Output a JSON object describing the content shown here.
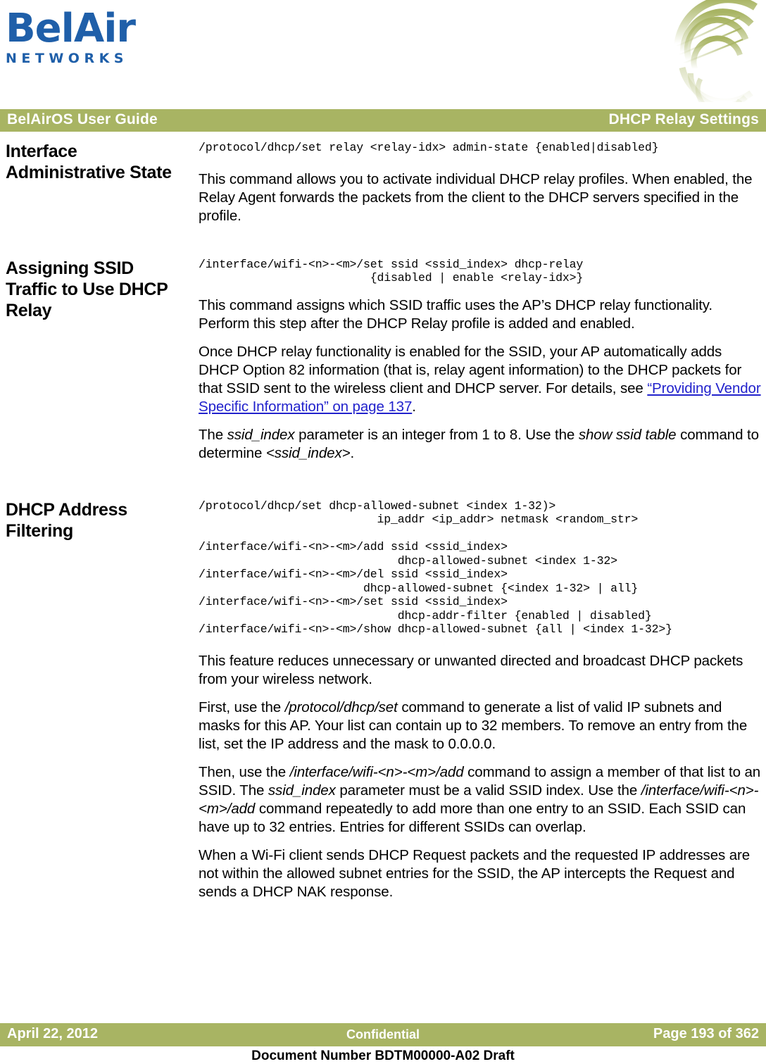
{
  "brand": {
    "logo_word": "BelAir",
    "logo_sub": "NETWORKS",
    "logo_color": "#1f5fa9",
    "accent_color": "#a8b463",
    "link_color": "#2222cc",
    "swoosh_icon": "wireless-swoosh-icon"
  },
  "header": {
    "left": "BelAirOS User Guide",
    "right": "DHCP Relay Settings"
  },
  "sections": [
    {
      "heading": "Interface Administrative State",
      "code": "/protocol/dhcp/set relay <relay-idx> admin-state {enabled|disabled}",
      "paragraphs": [
        "This command allows you to activate individual DHCP relay profiles. When enabled, the Relay Agent forwards the packets from the client to the DHCP servers specified in the profile."
      ]
    },
    {
      "heading": "Assigning SSID Traffic to Use DHCP Relay",
      "code": "/interface/wifi-<n>-<m>/set ssid <ssid_index> dhcp-relay\n                         {disabled | enable <relay-idx>}",
      "paragraphs": [
        "This command assigns which SSID traffic uses the AP’s DHCP relay functionality. Perform this step after the DHCP Relay profile is added and enabled."
      ],
      "para_link": {
        "before": "Once DHCP relay functionality is enabled for the SSID, your AP automatically adds DHCP Option 82 information (that is, relay agent information) to the DHCP packets for that SSID sent to the wireless client and DHCP server. For details, see ",
        "link": "“Providing Vendor Specific Information” on page 137",
        "after": "."
      },
      "para_italic": {
        "p1": "The ",
        "i1": "ssid_index",
        "p2": " parameter is an integer from 1 to 8. Use the ",
        "i2": "show ssid table",
        "p3": " command to determine ",
        "i3": "<ssid_index>",
        "p4": "."
      }
    },
    {
      "heading": "DHCP Address Filtering",
      "code": "/protocol/dhcp/set dhcp-allowed-subnet <index 1-32)>\n                          ip_addr <ip_addr> netmask <random_str>\n\n/interface/wifi-<n>-<m>/add ssid <ssid_index>\n                             dhcp-allowed-subnet <index 1-32>\n/interface/wifi-<n>-<m>/del ssid <ssid_index>\n                        dhcp-allowed-subnet {<index 1-32> | all}\n/interface/wifi-<n>-<m>/set ssid <ssid_index>\n                             dhcp-addr-filter {enabled | disabled}\n/interface/wifi-<n>-<m>/show dhcp-allowed-subnet {all | <index 1-32>}",
      "paragraphs": [
        "This feature reduces unnecessary or unwanted directed and broadcast DHCP packets from your wireless network."
      ],
      "para_first": {
        "p1": "First, use the ",
        "i1": "/protocol/dhcp/set",
        "p2": " command to generate a list of valid IP subnets and masks for this AP. Your list can contain up to 32 members. To remove an entry from the list, set the IP address and the mask to 0.0.0.0."
      },
      "para_then": {
        "p1": "Then, use the ",
        "i1": "/interface/wifi-<n>-<m>/add",
        "p2": " command to assign a member of that list to an SSID. The ",
        "i2": "ssid_index",
        "p3": " parameter must be a valid SSID index. Use the ",
        "i3": "/interface/wifi-<n>-<m>/add",
        "p4": " command repeatedly to add more than one entry to an SSID. Each SSID can have up to 32 entries. Entries for different SSIDs can overlap."
      },
      "para_last": "When a Wi-Fi client sends DHCP Request packets and the requested IP addresses are not within the allowed subnet entries for the SSID, the AP intercepts the Request and sends a DHCP NAK response."
    }
  ],
  "footer": {
    "date": "April 22, 2012",
    "classification": "Confidential",
    "page": "Page 193 of 362",
    "document_number": "Document Number BDTM00000-A02 Draft"
  }
}
